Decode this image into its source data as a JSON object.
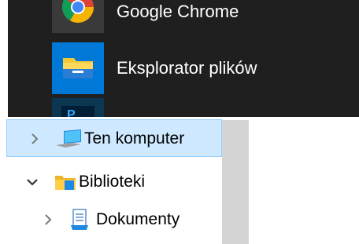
{
  "start_menu": {
    "apps": [
      {
        "label": "Google Chrome",
        "icon": "chrome-icon"
      },
      {
        "label": "Eksplorator plików",
        "icon": "file-explorer-icon"
      },
      {
        "label": "",
        "icon": "photoshop-icon"
      }
    ]
  },
  "nav_pane": {
    "items": [
      {
        "label": "Ten komputer",
        "icon": "computer-icon",
        "expanded": false,
        "selected": true
      },
      {
        "label": "Biblioteki",
        "icon": "libraries-folder-icon",
        "expanded": true,
        "selected": false
      },
      {
        "label": "Dokumenty",
        "icon": "documents-icon",
        "expanded": false,
        "selected": false
      }
    ]
  },
  "colors": {
    "start_bg": "#1f1f1f",
    "explorer_tile": "#0078d7",
    "selection_bg": "#cde8ff",
    "selection_border": "#99d1ff"
  }
}
